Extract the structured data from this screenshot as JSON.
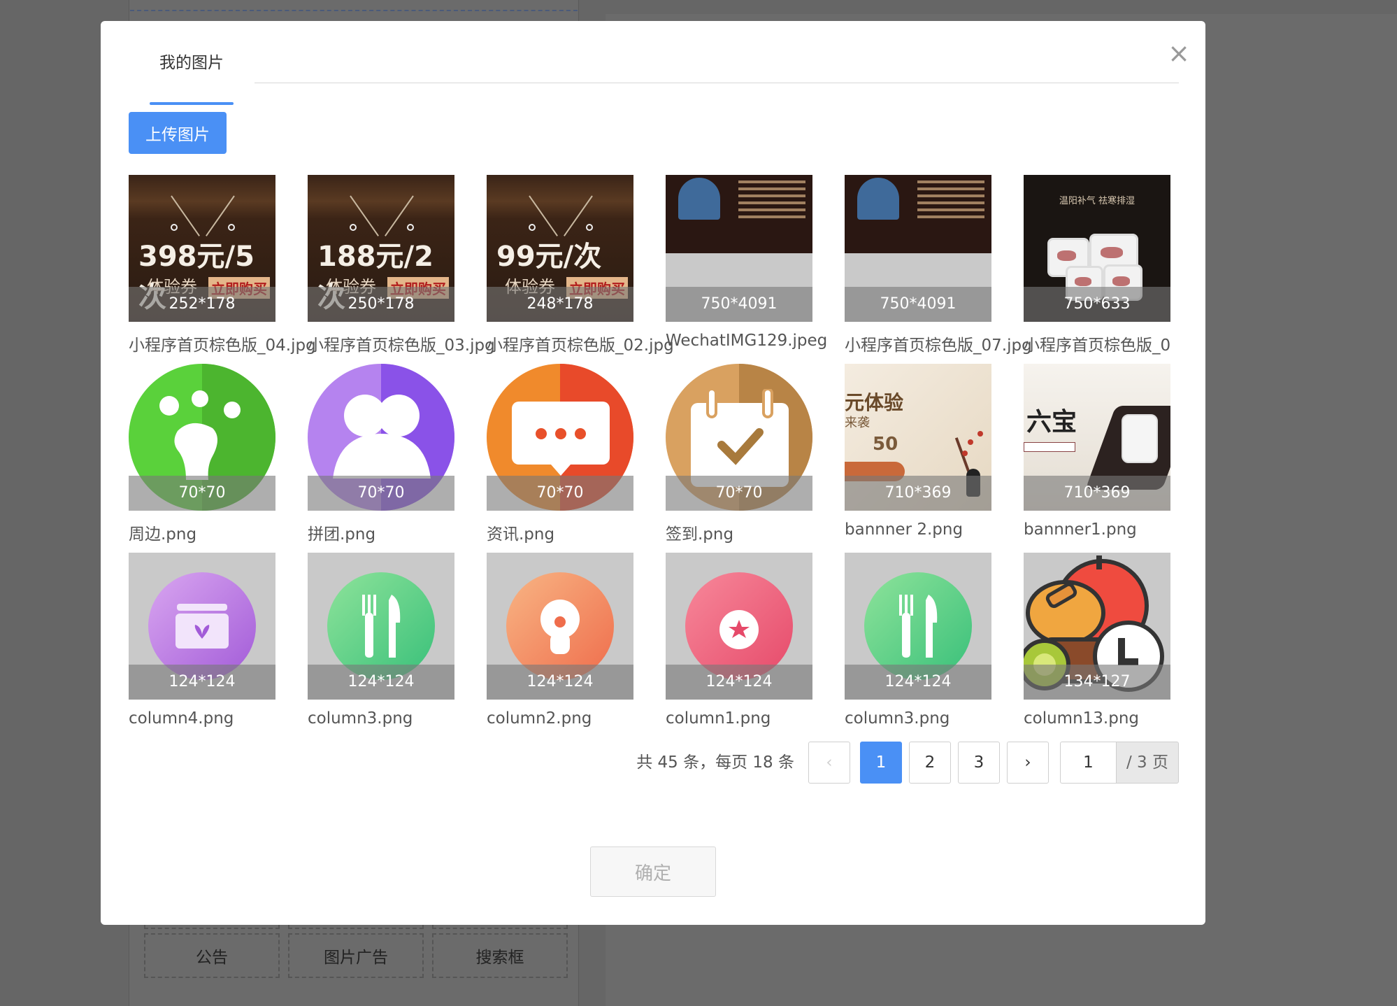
{
  "background": {
    "cells": [
      "公告",
      "图片广告",
      "搜索框"
    ]
  },
  "modal": {
    "tab_label": "我的图片",
    "upload_label": "上传图片",
    "items": [
      {
        "size": "252*178",
        "name": "小程序首页棕色版_04.jpg",
        "art": "wood",
        "price": "398元/5次"
      },
      {
        "size": "250*178",
        "name": "小程序首页棕色版_03.jpg",
        "art": "wood",
        "price": "188元/2次"
      },
      {
        "size": "248*178",
        "name": "小程序首页棕色版_02.jpg",
        "art": "wood",
        "price": "99元/次"
      },
      {
        "size": "750*4091",
        "name": "WechatIMG129.jpeg",
        "art": "dark"
      },
      {
        "size": "750*4091",
        "name": "小程序首页棕色版_07.jpg",
        "art": "dark"
      },
      {
        "size": "750*633",
        "name": "小程序首页棕色版_0",
        "art": "teacup"
      },
      {
        "size": "70*70",
        "name": "周边.png",
        "art": "icon-green"
      },
      {
        "size": "70*70",
        "name": "拼团.png",
        "art": "icon-purple"
      },
      {
        "size": "70*70",
        "name": "资讯.png",
        "art": "icon-orange"
      },
      {
        "size": "70*70",
        "name": "签到.png",
        "art": "icon-tan"
      },
      {
        "size": "710*369",
        "name": "bannner 2.png",
        "art": "banner-light"
      },
      {
        "size": "710*369",
        "name": "bannner1.png",
        "art": "banner-ink"
      },
      {
        "size": "124*124",
        "name": "column4.png",
        "art": "col-purple"
      },
      {
        "size": "124*124",
        "name": "column3.png",
        "art": "col-green"
      },
      {
        "size": "124*124",
        "name": "column2.png",
        "art": "col-orange"
      },
      {
        "size": "124*124",
        "name": "column1.png",
        "art": "col-pink"
      },
      {
        "size": "124*124",
        "name": "column3.png",
        "art": "col-green"
      },
      {
        "size": "134*127",
        "name": "column13.png",
        "art": "col-fruit"
      }
    ],
    "thumb_text": {
      "wood_sub": "体验券",
      "wood_buy": "立即购买",
      "teacup_title": "温阳补气 祛寒排湿",
      "banner_light_big": "元体验",
      "banner_light_mid": "来袭",
      "banner_light_fifty": "50",
      "banner_ink_kanji": "六宝"
    },
    "pagination": {
      "total_text": "共 45 条，每页 18 条",
      "prev": "‹",
      "pages": [
        "1",
        "2",
        "3"
      ],
      "current": "1",
      "next": "›",
      "jump_value": "1",
      "jump_total": "/ 3 页"
    },
    "confirm_label": "确定",
    "close_icon": "×"
  }
}
